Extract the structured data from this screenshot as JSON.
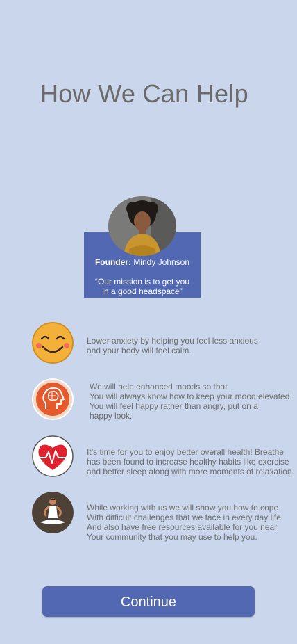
{
  "page": {
    "title": "How We Can Help"
  },
  "founder_card": {
    "label": "Founder:",
    "name": "Mindy Johnson",
    "quote": "“Our mission is to get you\n in a good headspace”"
  },
  "benefits": [
    {
      "icon": "smiley-face-icon",
      "text": "Lower anxiety by helping you feel less anxious\nand your body will feel calm."
    },
    {
      "icon": "brain-head-icon",
      "text": "We will help enhanced moods so that\nYou will always know how to keep your mood elevated.\n You will feel happy rather than angry, put on a\n happy look."
    },
    {
      "icon": "heart-pulse-icon",
      "text": "It’s time for you to enjoy better overall health! Breathe\nhas been found to increase healthy habits like exercise\nand better sleep along with more moments of relaxation."
    },
    {
      "icon": "meditation-person-icon",
      "text": "While working with us we will show you how to cope\nWith difficult challenges that we face in every day life\nAnd also have free resources available for you near\nYour community that you may use to help you."
    }
  ],
  "actions": {
    "continue_label": "Continue"
  },
  "colors": {
    "background": "#c9d6ec",
    "accent": "#5368b2"
  }
}
